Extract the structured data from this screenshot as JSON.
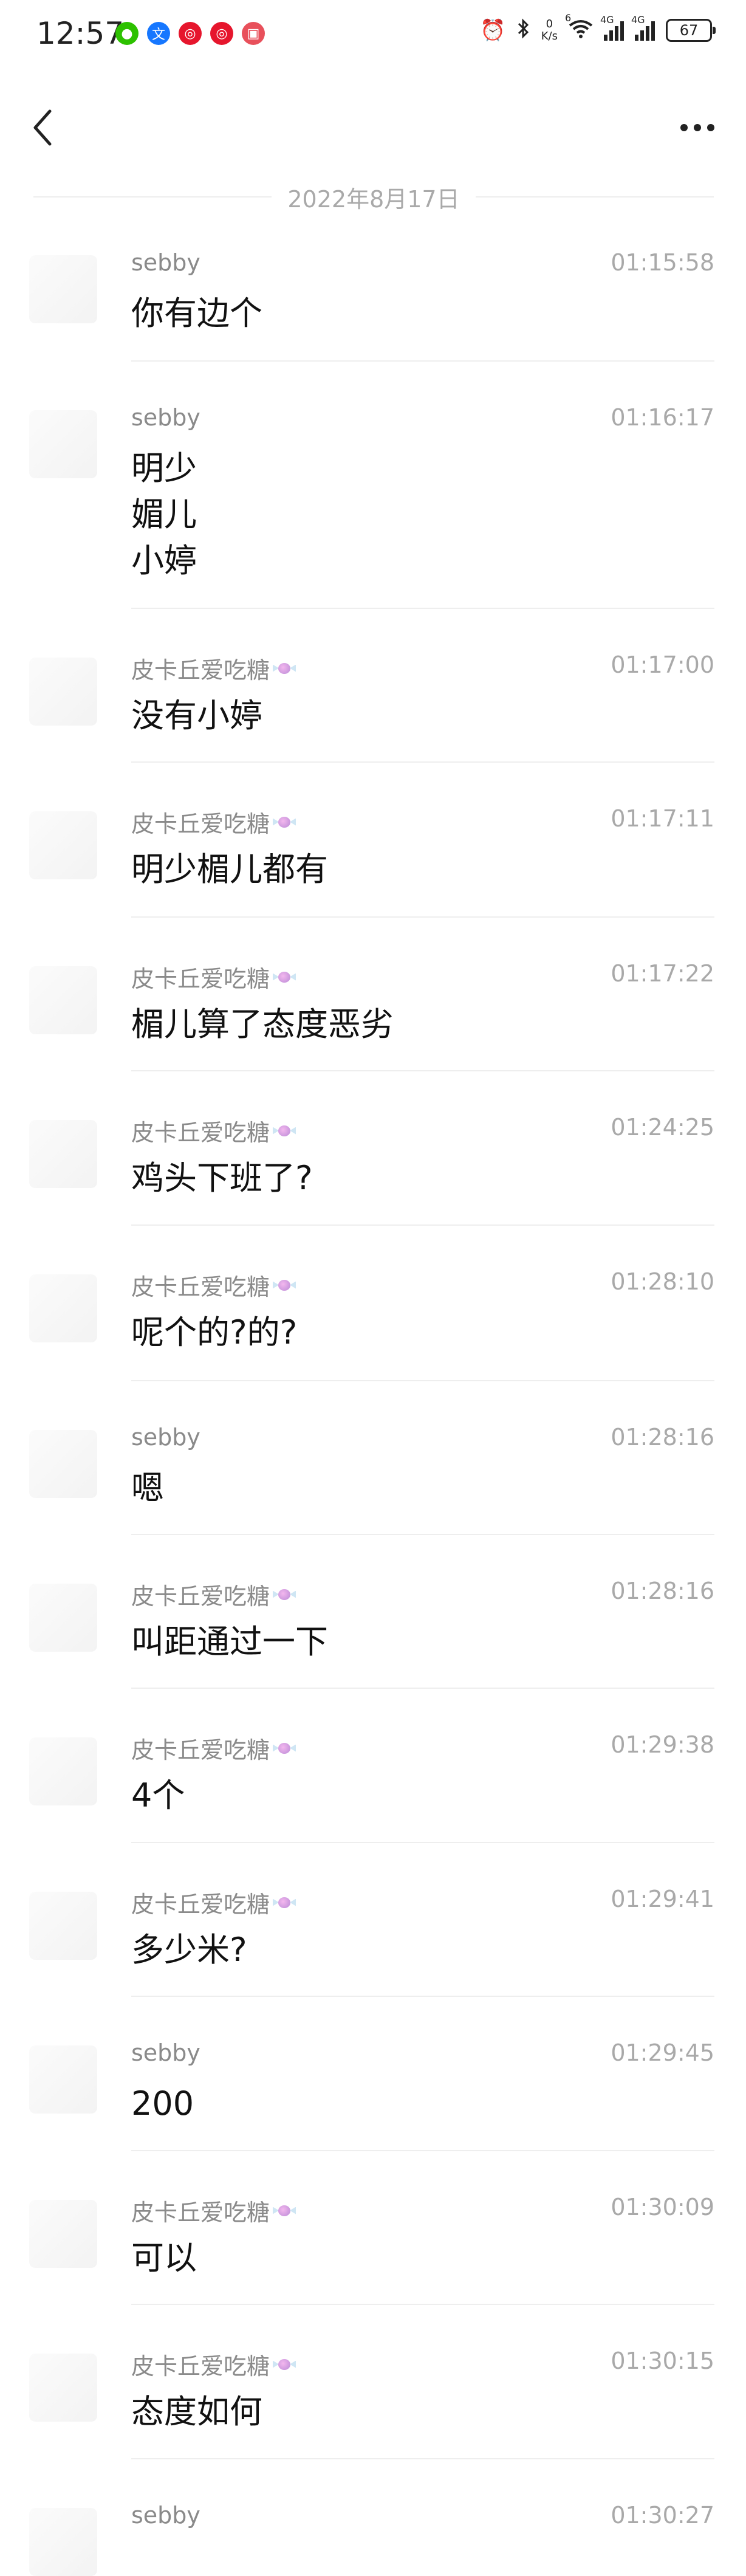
{
  "status_bar": {
    "time": "12:57",
    "net_speed_value": "0",
    "net_speed_unit": "K/s",
    "wifi_tag": "6",
    "signal1_tag": "4G",
    "signal2_tag": "4G",
    "battery": "67",
    "app_icons": [
      {
        "name": "wechat-icon",
        "color": "#2dc100",
        "glyph": "●"
      },
      {
        "name": "translate-icon",
        "color": "#1677ff",
        "glyph": "文"
      },
      {
        "name": "weibo-icon",
        "color": "#e6162d",
        "glyph": "◎"
      },
      {
        "name": "weibo-lite-icon",
        "color": "#e6162d",
        "glyph": "◎"
      },
      {
        "name": "gift-box-icon",
        "color": "#e8505b",
        "glyph": "▣"
      }
    ]
  },
  "header": {
    "back_icon": "chevron-left-icon",
    "more_icon": "more-dots-icon"
  },
  "date_divider": "2022年8月17日",
  "messages": [
    {
      "sender": "sebby",
      "time": "01:15:58",
      "text": "你有边个",
      "candy": false
    },
    {
      "sender": "sebby",
      "time": "01:16:17",
      "text": "明少\n媚儿\n小婷",
      "candy": false
    },
    {
      "sender": "皮卡丘爱吃糖",
      "time": "01:17:00",
      "text": "没有小婷",
      "candy": true
    },
    {
      "sender": "皮卡丘爱吃糖",
      "time": "01:17:11",
      "text": "明少楣儿都有",
      "candy": true
    },
    {
      "sender": "皮卡丘爱吃糖",
      "time": "01:17:22",
      "text": "楣儿算了态度恶劣",
      "candy": true
    },
    {
      "sender": "皮卡丘爱吃糖",
      "time": "01:24:25",
      "text": "鸡头下班了?",
      "candy": true
    },
    {
      "sender": "皮卡丘爱吃糖",
      "time": "01:28:10",
      "text": "呢个的?的?",
      "candy": true
    },
    {
      "sender": "sebby",
      "time": "01:28:16",
      "text": "嗯",
      "candy": false
    },
    {
      "sender": "皮卡丘爱吃糖",
      "time": "01:28:16",
      "text": "叫距通过一下",
      "candy": true
    },
    {
      "sender": "皮卡丘爱吃糖",
      "time": "01:29:38",
      "text": "4个",
      "candy": true
    },
    {
      "sender": "皮卡丘爱吃糖",
      "time": "01:29:41",
      "text": "多少米?",
      "candy": true
    },
    {
      "sender": "sebby",
      "time": "01:29:45",
      "text": "200",
      "candy": false
    },
    {
      "sender": "皮卡丘爱吃糖",
      "time": "01:30:09",
      "text": "可以",
      "candy": true
    },
    {
      "sender": "皮卡丘爱吃糖",
      "time": "01:30:15",
      "text": "态度如何",
      "candy": true
    },
    {
      "sender": "sebby",
      "time": "01:30:27",
      "text": "",
      "candy": false
    }
  ]
}
